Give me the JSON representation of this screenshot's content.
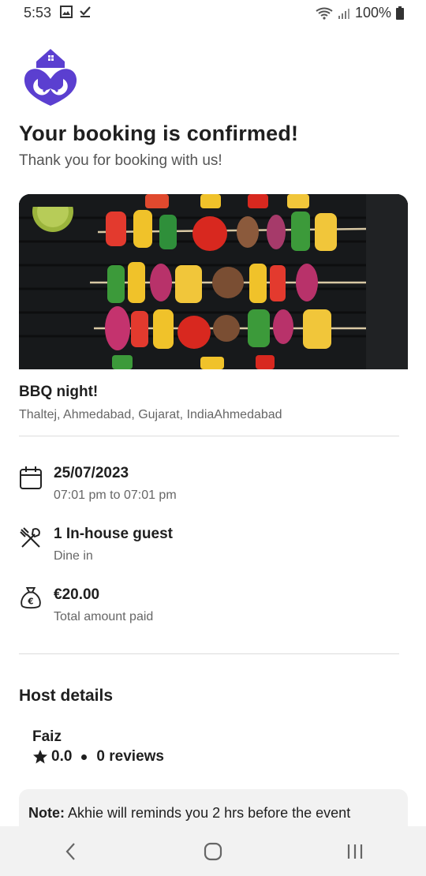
{
  "status_bar": {
    "time": "5:53",
    "battery": "100%",
    "icons": [
      "gallery-icon",
      "download-done-icon",
      "wifi-icon",
      "signal-icon",
      "battery-icon"
    ]
  },
  "brand": {
    "accent": "#5b3fd0"
  },
  "confirmation": {
    "title": "Your booking is confirmed!",
    "subtitle": "Thank you for booking with us!"
  },
  "event": {
    "name": "BBQ night!",
    "location": "Thaltej, Ahmedabad, Gujarat, IndiaAhmedabad"
  },
  "details": {
    "date": "25/07/2023",
    "time_range": "07:01 pm to 07:01 pm",
    "guests": "1 In-house guest",
    "dining_type": "Dine in",
    "amount": "€20.00",
    "amount_label": "Total amount paid"
  },
  "host": {
    "heading": "Host details",
    "name": "Faiz",
    "rating": "0.0",
    "reviews": "0 reviews"
  },
  "note": {
    "label": "Note:",
    "text": " Akhie will reminds you 2 hrs before the event"
  }
}
